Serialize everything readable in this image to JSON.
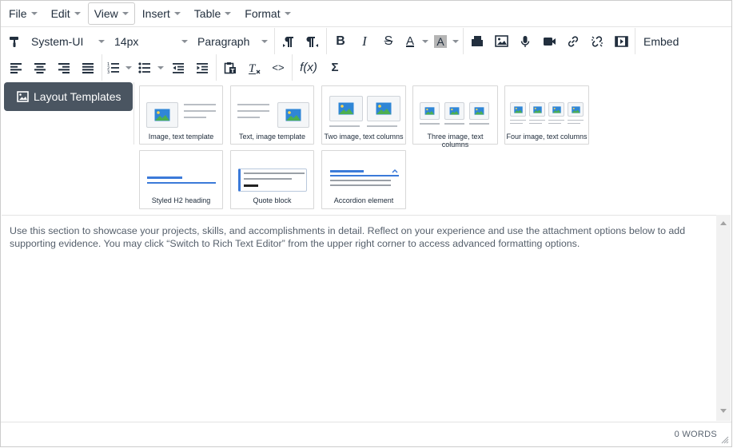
{
  "menubar": {
    "items": [
      {
        "label": "File"
      },
      {
        "label": "Edit"
      },
      {
        "label": "View"
      },
      {
        "label": "Insert"
      },
      {
        "label": "Table"
      },
      {
        "label": "Format"
      }
    ]
  },
  "toolbar": {
    "font_family": "System-UI",
    "font_size": "14px",
    "block_format": "Paragraph",
    "embed_label": "Embed",
    "function_label": "f(x)",
    "sigma_label": "Σ",
    "code_label": "<>",
    "bold_label": "B",
    "italic_label": "I",
    "strike_label": "S",
    "text_color_label": "A",
    "highlight_label": "A"
  },
  "layout_templates": {
    "button_label": "Layout Templates",
    "templates": [
      {
        "label": "Image, text template"
      },
      {
        "label": "Text, image template"
      },
      {
        "label": "Two image, text columns"
      },
      {
        "label": "Three image, text columns"
      },
      {
        "label": "Four image, text columns"
      },
      {
        "label": "Styled H2 heading"
      },
      {
        "label": "Quote block"
      },
      {
        "label": "Accordion element"
      }
    ]
  },
  "content": {
    "placeholder_text": "Use this section to showcase your projects, skills, and accomplishments in detail. Reflect on your experience and use the attachment options below to add supporting evidence. You may click “Switch to Rich Text Editor” from the upper right corner to access advanced formatting options."
  },
  "statusbar": {
    "word_count": "0 WORDS"
  },
  "colors": {
    "button_dark": "#4a5561",
    "accent_blue": "#3b7ad9",
    "image_green": "#4caf50",
    "text": "#222f3e"
  }
}
